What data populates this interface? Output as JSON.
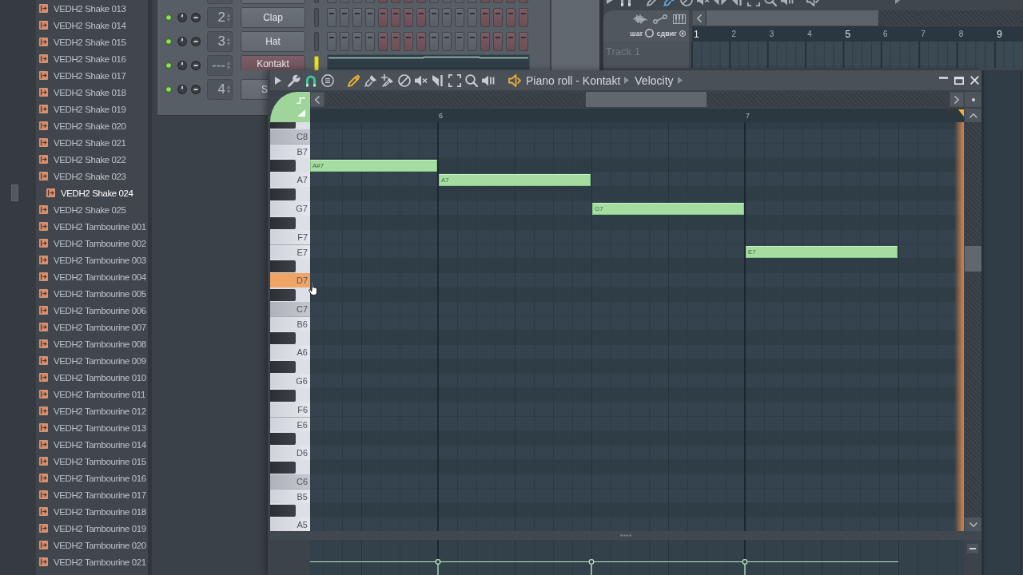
{
  "browser": {
    "items": [
      {
        "label": "VEDH2 Shake 013",
        "selected": false
      },
      {
        "label": "VEDH2 Shake 014",
        "selected": false
      },
      {
        "label": "VEDH2 Shake 015",
        "selected": false
      },
      {
        "label": "VEDH2 Shake 016",
        "selected": false
      },
      {
        "label": "VEDH2 Shake 017",
        "selected": false
      },
      {
        "label": "VEDH2 Shake 018",
        "selected": false
      },
      {
        "label": "VEDH2 Shake 019",
        "selected": false
      },
      {
        "label": "VEDH2 Shake 020",
        "selected": false
      },
      {
        "label": "VEDH2 Shake 021",
        "selected": false
      },
      {
        "label": "VEDH2 Shake 022",
        "selected": false
      },
      {
        "label": "VEDH2 Shake 023",
        "selected": false
      },
      {
        "label": "VEDH2 Shake 024",
        "selected": true
      },
      {
        "label": "VEDH2 Shake 025",
        "selected": false
      },
      {
        "label": "VEDH2 Tambourine 001",
        "selected": false
      },
      {
        "label": "VEDH2 Tambourine 002",
        "selected": false
      },
      {
        "label": "VEDH2 Tambourine 003",
        "selected": false
      },
      {
        "label": "VEDH2 Tambourine 004",
        "selected": false
      },
      {
        "label": "VEDH2 Tambourine 005",
        "selected": false
      },
      {
        "label": "VEDH2 Tambourine 006",
        "selected": false
      },
      {
        "label": "VEDH2 Tambourine 007",
        "selected": false
      },
      {
        "label": "VEDH2 Tambourine 008",
        "selected": false
      },
      {
        "label": "VEDH2 Tambourine 009",
        "selected": false
      },
      {
        "label": "VEDH2 Tambourine 010",
        "selected": false
      },
      {
        "label": "VEDH2 Tambourine 011",
        "selected": false
      },
      {
        "label": "VEDH2 Tambourine 012",
        "selected": false
      },
      {
        "label": "VEDH2 Tambourine 013",
        "selected": false
      },
      {
        "label": "VEDH2 Tambourine 014",
        "selected": false
      },
      {
        "label": "VEDH2 Tambourine 015",
        "selected": false
      },
      {
        "label": "VEDH2 Tambourine 016",
        "selected": false
      },
      {
        "label": "VEDH2 Tambourine 017",
        "selected": false
      },
      {
        "label": "VEDH2 Tambourine 018",
        "selected": false
      },
      {
        "label": "VEDH2 Tambourine 019",
        "selected": false
      },
      {
        "label": "VEDH2 Tambourine 020",
        "selected": false
      },
      {
        "label": "VEDH2 Tambourine 021",
        "selected": false
      }
    ]
  },
  "channel_rack": {
    "channels": [
      {
        "kind": "cut",
        "selected": false,
        "steps": [
          false,
          false,
          false,
          false,
          false,
          false,
          false,
          false,
          false,
          false,
          false,
          false,
          false,
          false,
          false,
          false
        ]
      },
      {
        "kind": "steps",
        "enabled": true,
        "number": "2",
        "name": "Clap",
        "selected": false,
        "steps": [
          false,
          false,
          false,
          false,
          false,
          false,
          false,
          false,
          false,
          false,
          false,
          false,
          false,
          false,
          false,
          false
        ]
      },
      {
        "kind": "steps",
        "enabled": true,
        "number": "3",
        "name": "Hat",
        "selected": false,
        "steps": [
          false,
          false,
          false,
          false,
          false,
          false,
          false,
          false,
          false,
          false,
          false,
          false,
          false,
          false,
          false,
          false
        ]
      },
      {
        "kind": "preview",
        "enabled": true,
        "number": "---",
        "name": "Kontakt",
        "selected": true
      },
      {
        "kind": "covered",
        "enabled": true,
        "number": "4",
        "name": "S",
        "selected": false
      }
    ]
  },
  "playlist": {
    "tools": [
      {
        "selected": false
      },
      {
        "selected": true
      },
      {
        "selected": false
      },
      {
        "selected": false
      },
      {
        "selected": false
      },
      {
        "selected": false
      },
      {
        "selected": false
      },
      {
        "selected": false
      },
      {
        "selected": false
      }
    ],
    "step_label": "шаг",
    "slide_label": "сдвиг",
    "ruler": [
      "1",
      "2",
      "3",
      "4",
      "5",
      "6",
      "7",
      "8",
      "9"
    ],
    "tracks": [
      {
        "name": "Track 1"
      }
    ]
  },
  "piano_roll": {
    "title_parts": [
      "Piano roll - Kontakt",
      "Velocity"
    ],
    "tools": [
      {
        "selected": true
      },
      {
        "selected": false
      },
      {
        "selected": false
      },
      {
        "selected": false
      },
      {
        "selected": false
      },
      {
        "selected": false
      },
      {
        "selected": false
      },
      {
        "selected": false
      },
      {
        "selected": false
      }
    ],
    "ruler": [
      "6",
      "7"
    ],
    "keys": [
      {
        "kind": "black",
        "pressed": false
      },
      {
        "kind": "c",
        "label": "C8",
        "pressed": false
      },
      {
        "kind": "white",
        "label": "B7",
        "pressed": false
      },
      {
        "kind": "black",
        "pressed": false
      },
      {
        "kind": "white",
        "label": "A7",
        "pressed": false
      },
      {
        "kind": "black",
        "pressed": false
      },
      {
        "kind": "white",
        "label": "G7",
        "pressed": false
      },
      {
        "kind": "black",
        "pressed": false
      },
      {
        "kind": "white",
        "label": "F7",
        "pressed": false
      },
      {
        "kind": "white",
        "label": "E7",
        "pressed": false
      },
      {
        "kind": "black",
        "pressed": false
      },
      {
        "kind": "white",
        "label": "D7",
        "pressed": true
      },
      {
        "kind": "black",
        "pressed": false
      },
      {
        "kind": "c",
        "label": "C7",
        "pressed": false
      },
      {
        "kind": "white",
        "label": "B6",
        "pressed": false
      },
      {
        "kind": "black",
        "pressed": false
      },
      {
        "kind": "white",
        "label": "A6",
        "pressed": false
      },
      {
        "kind": "black",
        "pressed": false
      },
      {
        "kind": "white",
        "label": "G6",
        "pressed": false
      },
      {
        "kind": "black",
        "pressed": false
      },
      {
        "kind": "white",
        "label": "F6",
        "pressed": false
      },
      {
        "kind": "white",
        "label": "E6",
        "pressed": false
      },
      {
        "kind": "black",
        "pressed": false
      },
      {
        "kind": "white",
        "label": "D6",
        "pressed": false
      },
      {
        "kind": "black",
        "pressed": false
      },
      {
        "kind": "c",
        "label": "C6",
        "pressed": false
      },
      {
        "kind": "white",
        "label": "B5",
        "pressed": false
      },
      {
        "kind": "black",
        "pressed": false
      },
      {
        "kind": "white",
        "label": "A5",
        "pressed": false
      }
    ],
    "notes": [
      {
        "label": "A#7"
      },
      {
        "label": "A7"
      },
      {
        "label": "G7"
      },
      {
        "label": "E7"
      }
    ]
  }
}
